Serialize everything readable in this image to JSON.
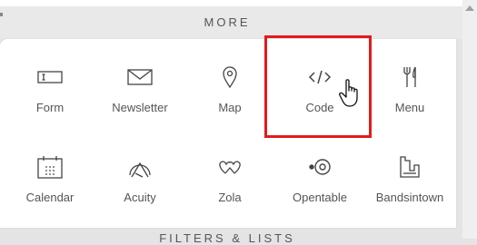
{
  "section": {
    "title": "MORE"
  },
  "next_section": {
    "title": "FILTERS & LISTS"
  },
  "blocks": [
    {
      "label": "Form",
      "icon": "form-icon"
    },
    {
      "label": "Newsletter",
      "icon": "newsletter-icon"
    },
    {
      "label": "Map",
      "icon": "map-icon"
    },
    {
      "label": "Code",
      "icon": "code-icon"
    },
    {
      "label": "Menu",
      "icon": "menu-icon"
    },
    {
      "label": "Calendar",
      "icon": "calendar-icon"
    },
    {
      "label": "Acuity",
      "icon": "acuity-icon"
    },
    {
      "label": "Zola",
      "icon": "zola-icon"
    },
    {
      "label": "Opentable",
      "icon": "opentable-icon"
    },
    {
      "label": "Bandsintown",
      "icon": "bandsintown-icon"
    }
  ],
  "colors": {
    "highlight": "#e11b1b",
    "text": "#555555",
    "panel": "#ffffff",
    "background": "#e4e4e4"
  }
}
